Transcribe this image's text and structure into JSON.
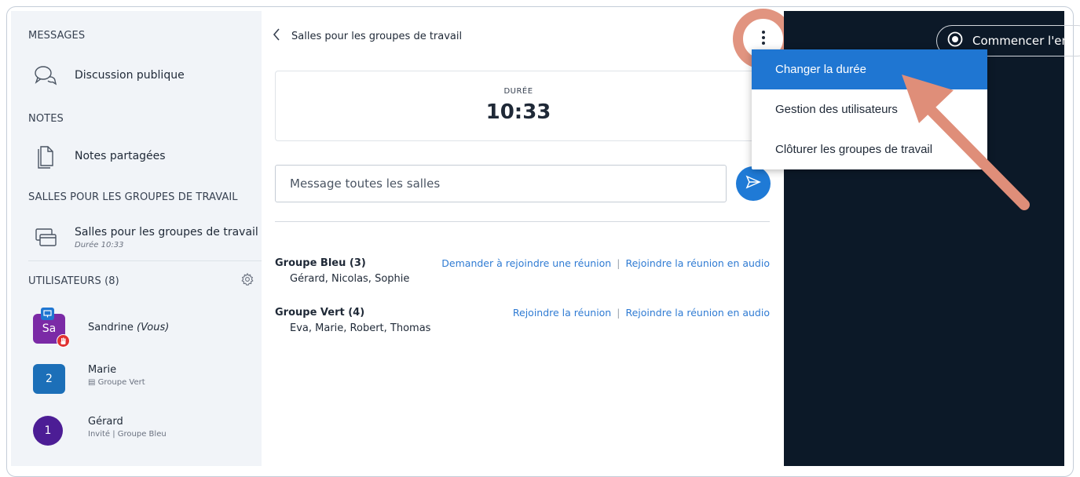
{
  "sidebar": {
    "messages_title": "MESSAGES",
    "public_chat": "Discussion publique",
    "notes_title": "NOTES",
    "shared_notes": "Notes partagées",
    "breakout_title": "SALLES POUR LES GROUPES DE TRAVAIL",
    "breakout_item": "Salles pour les groupes de travail",
    "breakout_sub": "Durée 10:33",
    "users_title": "UTILISATEURS (8)",
    "users": [
      {
        "initials": "Sa",
        "name": "Sandrine",
        "you": "(Vous)",
        "sub": "",
        "color": "#7b2aa6"
      },
      {
        "initials": "2",
        "name": "Marie",
        "you": "",
        "sub": "Groupe Vert",
        "color": "#1c6fb8"
      },
      {
        "initials": "1",
        "name": "Gérard",
        "you": "",
        "sub": "Invité | Groupe Bleu",
        "color": "#4c1d95"
      }
    ]
  },
  "panel": {
    "back_label": "Salles pour les groupes de travail",
    "duration_label": "DURÉE",
    "duration_value": "10:33",
    "message_placeholder": "Message toutes les salles",
    "groups": [
      {
        "name": "Groupe Bleu (3)",
        "members": "Gérard, Nicolas, Sophie",
        "link1": "Demander à rejoindre une réunion",
        "link2": "Rejoindre la réunion en audio"
      },
      {
        "name": "Groupe Vert (4)",
        "members": "Eva, Marie, Robert, Thomas",
        "link1": "Rejoindre la réunion",
        "link2": "Rejoindre la réunion en audio"
      }
    ]
  },
  "topbar": {
    "record_label": "Commencer l'en"
  },
  "menu": {
    "items": [
      "Changer la durée",
      "Gestion des utilisateurs",
      "Clôturer les groupes de travail"
    ]
  },
  "colors": {
    "accent": "#1f76d2",
    "link": "#2f7bd3",
    "highlight": "#df8e79",
    "dark_bg": "#0c1928"
  }
}
